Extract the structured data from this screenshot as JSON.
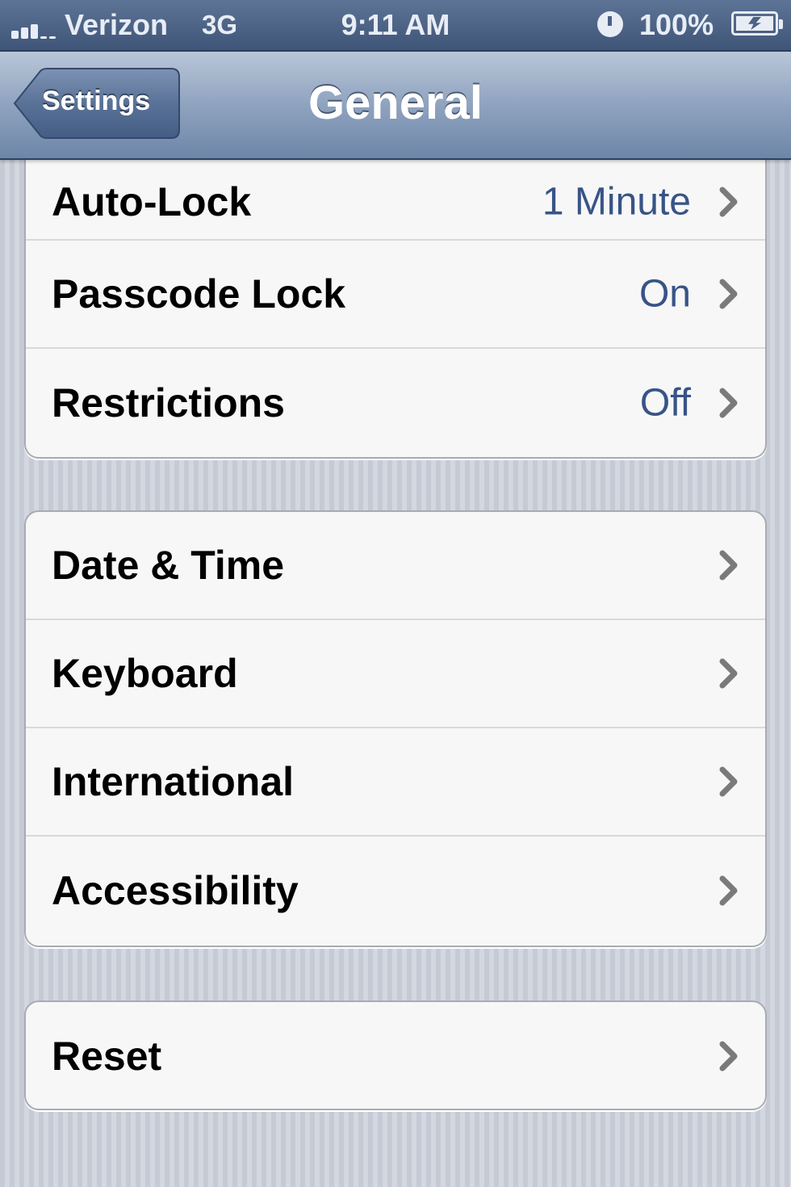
{
  "status_bar": {
    "carrier": "Verizon",
    "network": "3G",
    "time": "9:11 AM",
    "battery_percent": "100%",
    "signal_icon": "signal-bars-icon",
    "orientation_icon": "orientation-lock-icon",
    "battery_icon": "battery-charging-icon"
  },
  "nav": {
    "back_label": "Settings",
    "title": "General"
  },
  "groups": [
    {
      "rows": [
        {
          "label": "Auto-Lock",
          "value": "1 Minute"
        },
        {
          "label": "Passcode Lock",
          "value": "On"
        },
        {
          "label": "Restrictions",
          "value": "Off"
        }
      ]
    },
    {
      "rows": [
        {
          "label": "Date & Time"
        },
        {
          "label": "Keyboard"
        },
        {
          "label": "International"
        },
        {
          "label": "Accessibility"
        }
      ]
    },
    {
      "rows": [
        {
          "label": "Reset"
        }
      ]
    }
  ],
  "colors": {
    "value_text": "#385487",
    "nav_bar": "#8fa3bf",
    "status_bar": "#4b6185"
  }
}
